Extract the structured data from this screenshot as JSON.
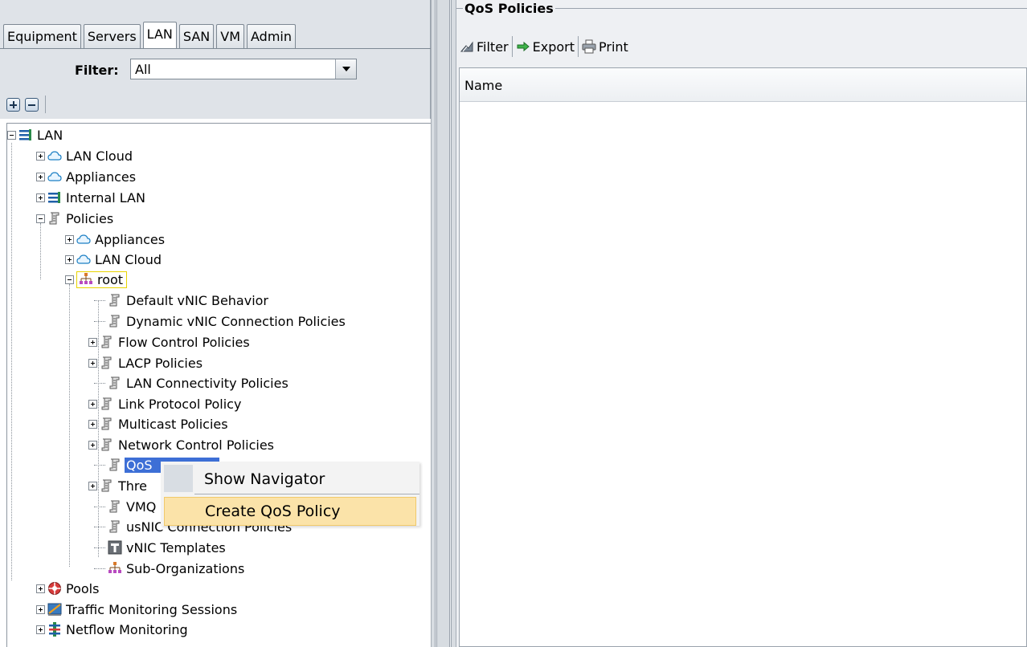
{
  "nav": {
    "tabs": [
      "Equipment",
      "Servers",
      "LAN",
      "SAN",
      "VM",
      "Admin"
    ],
    "active_tab": "LAN",
    "filter_label": "Filter:",
    "filter_value": "All"
  },
  "tree": {
    "lan": "LAN",
    "lan_cloud": "LAN Cloud",
    "appliances": "Appliances",
    "internal_lan": "Internal LAN",
    "policies": "Policies",
    "policies_appliances": "Appliances",
    "policies_lan_cloud": "LAN Cloud",
    "root": "root",
    "default_vnic": "Default vNIC Behavior",
    "dynamic_vnic": "Dynamic vNIC Connection Policies",
    "flow_control": "Flow Control Policies",
    "lacp": "LACP Policies",
    "lan_connectivity": "LAN Connectivity Policies",
    "link_protocol": "Link Protocol Policy",
    "multicast": "Multicast Policies",
    "network_control": "Network Control Policies",
    "qos_partial": "QoS",
    "thre_partial": "Thre",
    "vmq_partial": "VMQ",
    "usnic": "usNIC Connection Policies",
    "vnic_templates": "vNIC Templates",
    "sub_orgs": "Sub-Organizations",
    "pools": "Pools",
    "traffic_monitoring": "Traffic Monitoring Sessions",
    "netflow": "Netflow Monitoring"
  },
  "content": {
    "title": "QoS Policies",
    "toolbar": {
      "filter": "Filter",
      "export": "Export",
      "print": "Print"
    },
    "table": {
      "columns": [
        "Name"
      ]
    }
  },
  "context_menu": {
    "show_navigator": "Show Navigator",
    "create_qos_policy": "Create QoS Policy"
  },
  "colors": {
    "selection": "#3d6fd6",
    "menu_highlight": "#fbe3a9",
    "panel_bg": "#dfe3e8"
  }
}
